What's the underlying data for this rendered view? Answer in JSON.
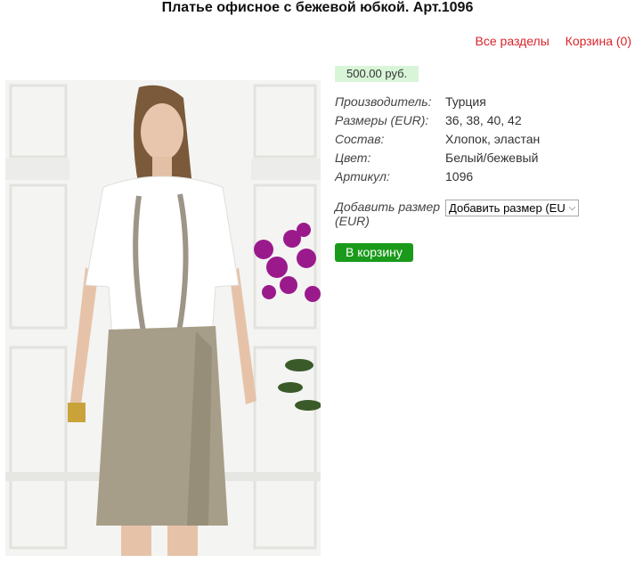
{
  "title": "Платье офисное с бежевой юбкой. Арт.1096",
  "links": {
    "sections": "Все разделы",
    "cart": "Корзина (0)"
  },
  "price": "500.00 руб.",
  "properties": [
    {
      "label": "Производитель:",
      "value": "Турция"
    },
    {
      "label": "Размеры (EUR):",
      "value": "36, 38, 40, 42"
    },
    {
      "label": "Состав:",
      "value": "Хлопок, эластан"
    },
    {
      "label": "Цвет:",
      "value": "Белый/бежевый"
    },
    {
      "label": "Артикул:",
      "value": "1096"
    }
  ],
  "size": {
    "label": "Добавить размер (EUR)",
    "selected": "Добавить размер (EU"
  },
  "cart_button": "В корзину",
  "colors": {
    "link": "#d8232a",
    "button": "#1a9a1a",
    "price_bg": "#d9f5d8"
  }
}
